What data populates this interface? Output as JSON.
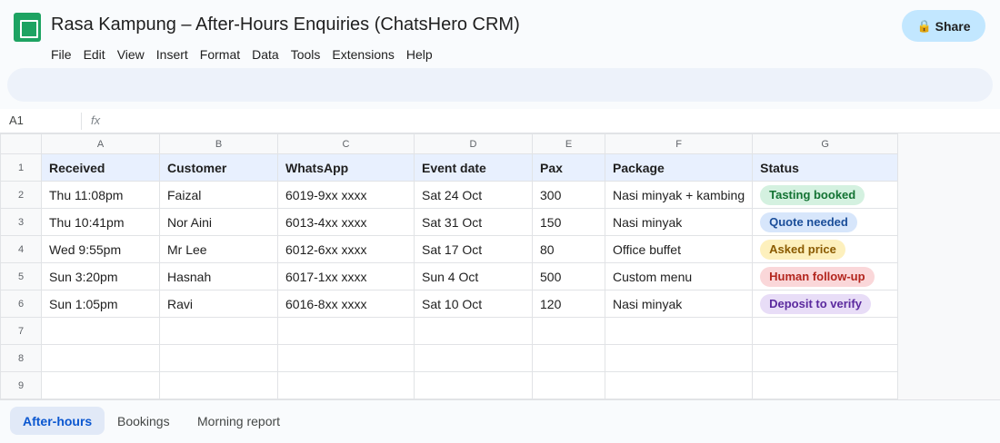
{
  "doc": {
    "title": "Rasa Kampung – After-Hours Enquiries (ChatsHero CRM)",
    "icon": "sheets-icon",
    "share_label": "Share",
    "share_icon": "lock-icon"
  },
  "menu": [
    "File",
    "Edit",
    "View",
    "Insert",
    "Format",
    "Data",
    "Tools",
    "Extensions",
    "Help"
  ],
  "formula_bar": {
    "cell_ref": "A1",
    "fx_label": "fx",
    "value": ""
  },
  "columns": [
    "A",
    "B",
    "C",
    "D",
    "E",
    "F",
    "G"
  ],
  "row_numbers": [
    "1",
    "2",
    "3",
    "4",
    "5",
    "6",
    "7",
    "8",
    "9"
  ],
  "table": {
    "headers": [
      "Received",
      "Customer",
      "WhatsApp",
      "Event date",
      "Pax",
      "Package",
      "Status"
    ],
    "rows": [
      [
        "Thu 11:08pm",
        "Faizal",
        "6019-9xx xxxx",
        "Sat 24 Oct",
        "300",
        "Nasi minyak + kambing",
        "Tasting booked"
      ],
      [
        "Thu 10:41pm",
        "Nor Aini",
        "6013-4xx xxxx",
        "Sat 31 Oct",
        "150",
        "Nasi minyak",
        "Quote needed"
      ],
      [
        "Wed 9:55pm",
        "Mr Lee",
        "6012-6xx xxxx",
        "Sat 17 Oct",
        "80",
        "Office buffet",
        "Asked price"
      ],
      [
        "Sun 3:20pm",
        "Hasnah",
        "6017-1xx xxxx",
        "Sun 4 Oct",
        "500",
        "Custom menu",
        "Human follow-up"
      ],
      [
        "Sun 1:05pm",
        "Ravi",
        "6016-8xx xxxx",
        "Sat 10 Oct",
        "120",
        "Nasi minyak",
        "Deposit to verify"
      ]
    ],
    "empty_rows": 3
  },
  "status_colors": {
    "Tasting booked": {
      "bg": "#d4f1e0",
      "fg": "#137333"
    },
    "Quote needed": {
      "bg": "#d7e6fb",
      "fg": "#1a4d99"
    },
    "Asked price": {
      "bg": "#fdf0bd",
      "fg": "#8a5a00"
    },
    "Human follow-up": {
      "bg": "#fad7d9",
      "fg": "#b3261e"
    },
    "Deposit to verify": {
      "bg": "#e8ddf7",
      "fg": "#5b2a9e"
    }
  },
  "tabs": [
    {
      "label": "After-hours",
      "active": true
    },
    {
      "label": "Bookings",
      "active": false
    },
    {
      "label": "Morning report",
      "active": false
    }
  ]
}
